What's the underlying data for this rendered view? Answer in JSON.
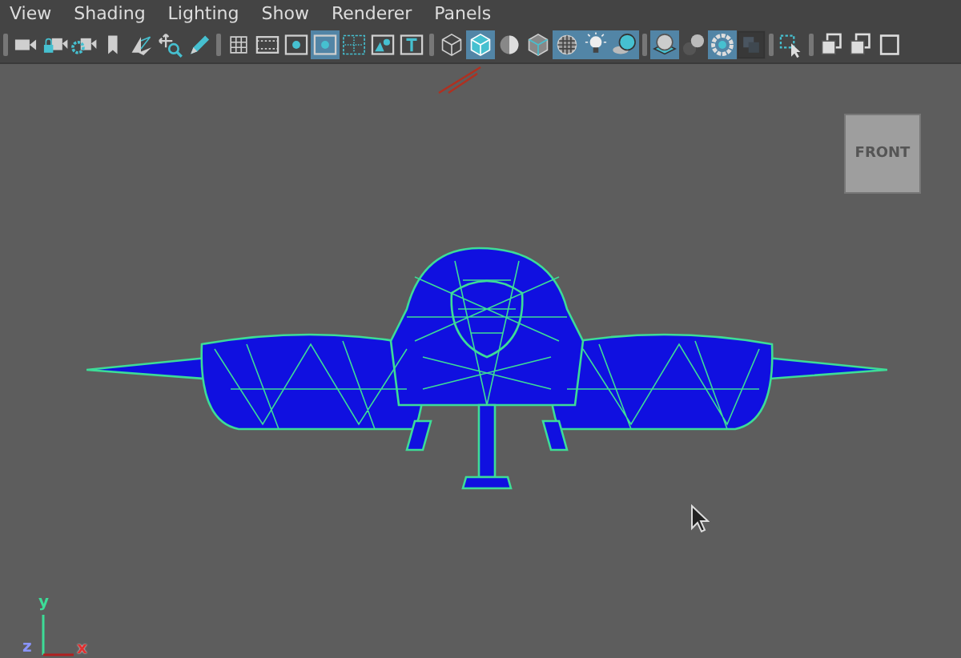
{
  "menu": [
    {
      "label": "View"
    },
    {
      "label": "Shading"
    },
    {
      "label": "Lighting"
    },
    {
      "label": "Show"
    },
    {
      "label": "Renderer"
    },
    {
      "label": "Panels"
    }
  ],
  "toolbar": [
    {
      "kind": "separator"
    },
    {
      "kind": "camera",
      "selected": false
    },
    {
      "kind": "camera-lock",
      "selected": false
    },
    {
      "kind": "camera-gear",
      "selected": false
    },
    {
      "kind": "bookmark",
      "selected": false
    },
    {
      "kind": "image-plane",
      "selected": false
    },
    {
      "kind": "pan",
      "selected": false
    },
    {
      "kind": "pencil",
      "selected": false
    },
    {
      "kind": "separator"
    },
    {
      "kind": "grid",
      "selected": false
    },
    {
      "kind": "film",
      "selected": false
    },
    {
      "kind": "dot",
      "selected": false
    },
    {
      "kind": "dot",
      "selected": true
    },
    {
      "kind": "field",
      "selected": false
    },
    {
      "kind": "safe",
      "selected": false
    },
    {
      "kind": "title",
      "selected": false
    },
    {
      "kind": "separator"
    },
    {
      "kind": "wire-cube",
      "selected": false
    },
    {
      "kind": "solid-cube",
      "selected": true
    },
    {
      "kind": "half-sphere",
      "selected": false
    },
    {
      "kind": "wire-solid-cube",
      "selected": false
    },
    {
      "kind": "checker",
      "selected": true
    },
    {
      "kind": "bulb",
      "selected": true
    },
    {
      "kind": "shadow",
      "selected": true
    },
    {
      "kind": "separator"
    },
    {
      "kind": "ao",
      "selected": true
    },
    {
      "kind": "spheres",
      "selected": false
    },
    {
      "kind": "ring",
      "selected": true
    },
    {
      "kind": "squares",
      "selected": false
    },
    {
      "kind": "separator"
    },
    {
      "kind": "select",
      "selected": false
    },
    {
      "kind": "separator"
    },
    {
      "kind": "overlap",
      "selected": false
    },
    {
      "kind": "overlap",
      "selected": false
    },
    {
      "kind": "square",
      "selected": false
    }
  ],
  "view_cube": {
    "label": "FRONT"
  },
  "axes": [
    {
      "label": "y"
    },
    {
      "label": "z"
    },
    {
      "label": "x"
    }
  ]
}
